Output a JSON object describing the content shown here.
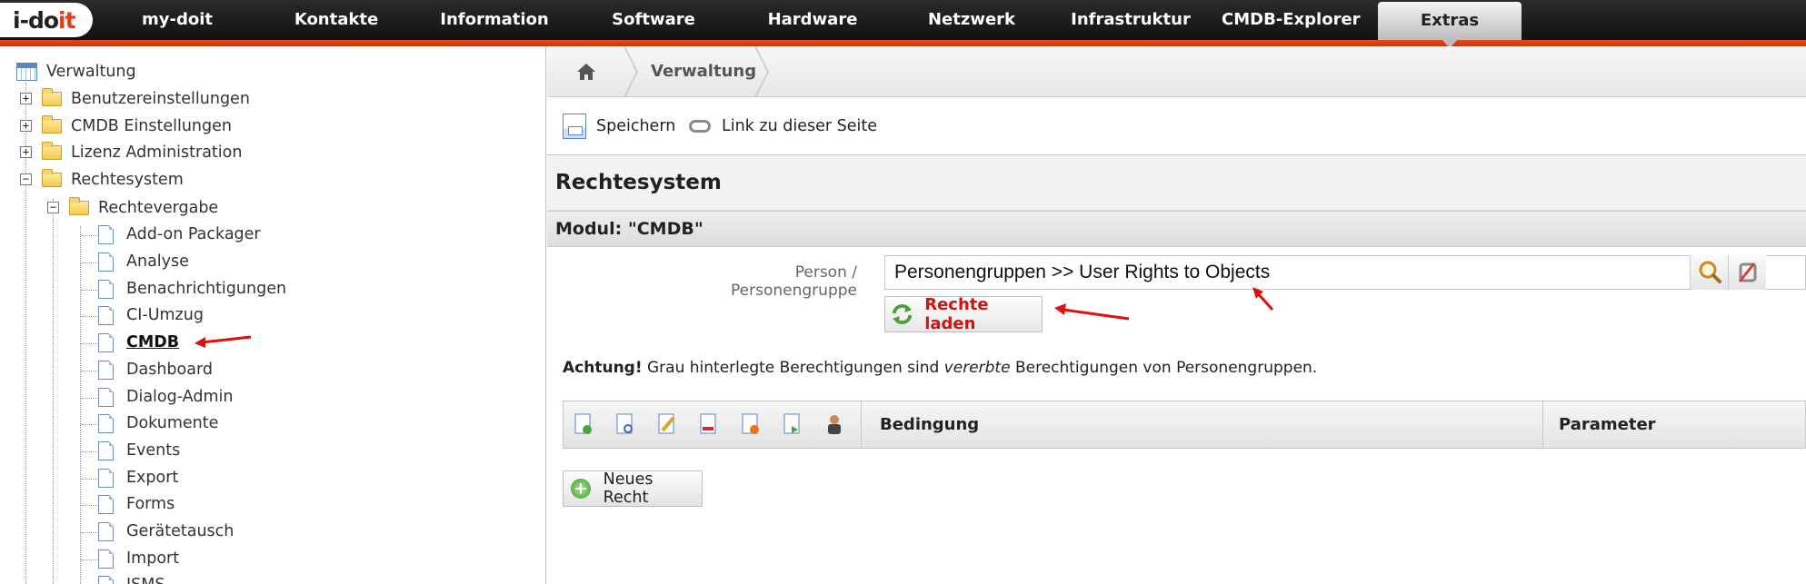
{
  "nav": {
    "logo": {
      "left": "i-do",
      "right": "it"
    },
    "items": [
      "my-doit",
      "Kontakte",
      "Information",
      "Software",
      "Hardware",
      "Netzwerk",
      "Infrastruktur",
      "CMDB-Explorer"
    ],
    "active": "Extras"
  },
  "tree": {
    "root": "Verwaltung",
    "top_level": [
      "Benutzereinstellungen",
      "CMDB Einstellungen",
      "Lizenz Administration",
      "Rechtesystem"
    ],
    "sub_folder": "Rechtevergabe",
    "pages": [
      "Add-on Packager",
      "Analyse",
      "Benachrichtigungen",
      "CI-Umzug",
      "CMDB",
      "Dashboard",
      "Dialog-Admin",
      "Dokumente",
      "Events",
      "Export",
      "Forms",
      "Gerätetausch",
      "Import",
      "ISMS"
    ],
    "selected": "CMDB"
  },
  "breadcrumb": {
    "current": "Verwaltung"
  },
  "toolbar": {
    "save_label": "Speichern",
    "link_label": "Link zu dieser Seite"
  },
  "section_title": "Rechtesystem",
  "module_title": "Modul: \"CMDB\"",
  "form": {
    "person_label": "Person / Personengruppe",
    "person_value": "Personengruppen >> User Rights to Objects",
    "load_rights_label": "Rechte laden"
  },
  "warning": {
    "bold": "Achtung!",
    "text1": "Grau hinterlegte Berechtigungen sind",
    "italic": "vererbte",
    "text2": "Berechtigungen von Personengruppen."
  },
  "table": {
    "columns": [
      "Bedingung",
      "Parameter"
    ],
    "action_icons": [
      "create-icon",
      "view-icon",
      "edit-icon",
      "delete-icon",
      "archive-icon",
      "execute-icon",
      "supervisor-icon"
    ]
  },
  "new_right_label": "Neues Recht",
  "colors": {
    "accent": "#d9421c",
    "load_label": "#cc1414",
    "nav_bg": "#1a1a1a"
  }
}
